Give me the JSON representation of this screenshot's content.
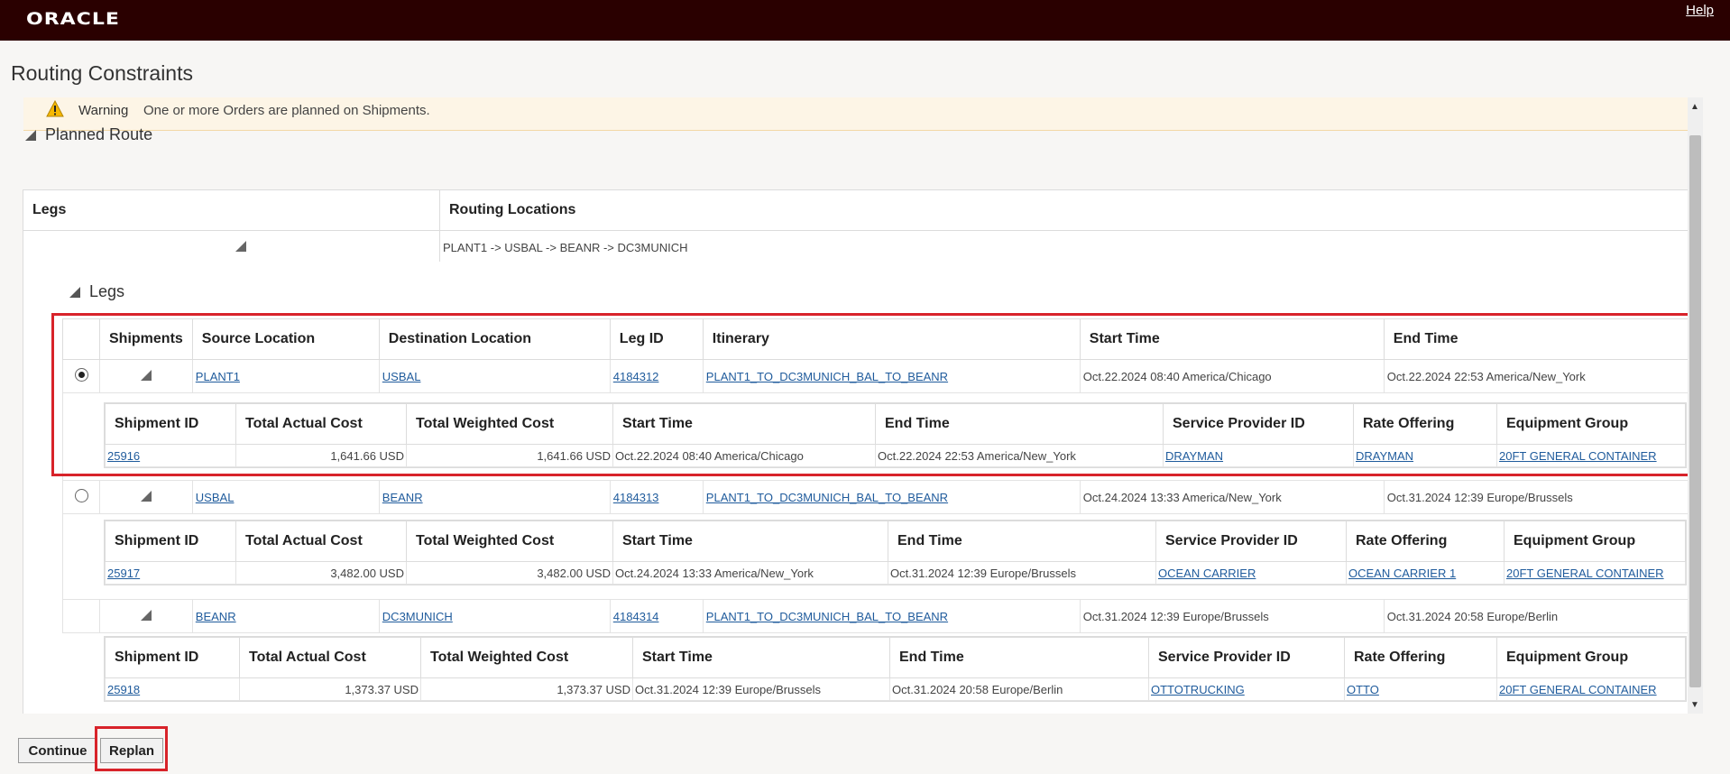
{
  "app": {
    "logo": "ORACLE",
    "help": "Help"
  },
  "page": {
    "title": "Routing Constraints"
  },
  "warning": {
    "label": "Warning",
    "message": "One or more Orders are planned on Shipments."
  },
  "planned_route": {
    "heading": "Planned Route",
    "col_legs": "Legs",
    "col_routing": "Routing Locations",
    "routing_value": "PLANT1 -> USBAL -> BEANR -> DC3MUNICH"
  },
  "legs": {
    "heading": "Legs",
    "headers": [
      "Shipments",
      "Source Location",
      "Destination Location",
      "Leg ID",
      "Itinerary",
      "Start Time",
      "End Time"
    ],
    "rows": [
      {
        "selected": true,
        "source": "PLANT1",
        "destination": "USBAL",
        "leg_id": "4184312",
        "itinerary": "PLANT1_TO_DC3MUNICH_BAL_TO_BEANR",
        "start": "Oct.22.2024 08:40 America/Chicago",
        "end": "Oct.22.2024 22:53 America/New_York",
        "shipment": {
          "id": "25916",
          "actual_cost": "1,641.66 USD",
          "weighted_cost": "1,641.66 USD",
          "start": "Oct.22.2024 08:40 America/Chicago",
          "end": "Oct.22.2024 22:53 America/New_York",
          "provider": "DRAYMAN",
          "rate": "DRAYMAN",
          "equipment": "20FT GENERAL CONTAINER"
        }
      },
      {
        "selected": false,
        "source": "USBAL",
        "destination": "BEANR",
        "leg_id": "4184313",
        "itinerary": "PLANT1_TO_DC3MUNICH_BAL_TO_BEANR",
        "start": "Oct.24.2024 13:33 America/New_York",
        "end": "Oct.31.2024 12:39 Europe/Brussels",
        "shipment": {
          "id": "25917",
          "actual_cost": "3,482.00 USD",
          "weighted_cost": "3,482.00 USD",
          "start": "Oct.24.2024 13:33 America/New_York",
          "end": "Oct.31.2024 12:39 Europe/Brussels",
          "provider": "OCEAN CARRIER",
          "rate": "OCEAN CARRIER 1",
          "equipment": "20FT GENERAL CONTAINER"
        }
      },
      {
        "selected": false,
        "source": "BEANR",
        "destination": "DC3MUNICH",
        "leg_id": "4184314",
        "itinerary": "PLANT1_TO_DC3MUNICH_BAL_TO_BEANR",
        "start": "Oct.31.2024 12:39 Europe/Brussels",
        "end": "Oct.31.2024 20:58 Europe/Berlin",
        "shipment": {
          "id": "25918",
          "actual_cost": "1,373.37 USD",
          "weighted_cost": "1,373.37 USD",
          "start": "Oct.31.2024 12:39 Europe/Brussels",
          "end": "Oct.31.2024 20:58 Europe/Berlin",
          "provider": "OTTOTRUCKING",
          "rate": "OTTO",
          "equipment": "20FT GENERAL CONTAINER"
        }
      }
    ],
    "shipment_headers": [
      "Shipment ID",
      "Total Actual Cost",
      "Total Weighted Cost",
      "Start Time",
      "End Time",
      "Service Provider ID",
      "Rate Offering",
      "Equipment Group"
    ]
  },
  "buttons": {
    "continue": "Continue",
    "replan": "Replan"
  },
  "colors": {
    "header_bg": "#2a0000",
    "link": "#1f5b9c",
    "highlight": "#d8232a",
    "warning_bg": "#fdf5e6"
  },
  "icons": [
    "warning-icon",
    "collapse-triangle-icon",
    "radio-button"
  ]
}
